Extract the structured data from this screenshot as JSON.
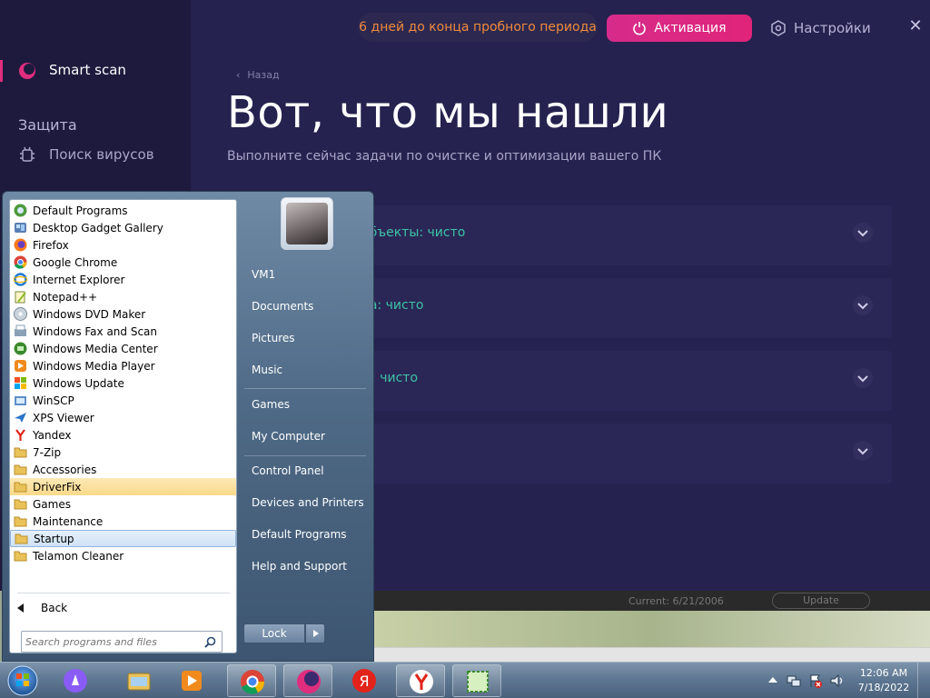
{
  "app": {
    "trial_text": "6 дней до конца пробного периода",
    "activate_label": "Активация",
    "settings_label": "Настройки",
    "close_glyph": "✕",
    "accent_color": "#e0247a",
    "sidebar": {
      "active_item": "Smart scan",
      "section_title": "Защита",
      "sub_item": "Поиск вирусов"
    },
    "back_label": "Назад",
    "title": "Вот, что мы нашли",
    "subtitle": "Выполните сейчас задачи по очистке и оптимизации вашего ПК",
    "results": [
      {
        "text": "объекты: чисто",
        "status_color": "#3fc3a6"
      },
      {
        "text": "ра: чисто",
        "status_color": "#3fc3a6"
      },
      {
        "text": "ы: чисто",
        "status_color": "#3fc3a6"
      },
      {
        "text": ""
      }
    ],
    "status_strip": {
      "current": "Current: 6/21/2006",
      "update": "Update"
    }
  },
  "start_menu": {
    "programs": [
      {
        "label": "Default Programs",
        "icon": "default-programs-icon"
      },
      {
        "label": "Desktop Gadget Gallery",
        "icon": "gadget-icon"
      },
      {
        "label": "Firefox",
        "icon": "firefox-icon"
      },
      {
        "label": "Google Chrome",
        "icon": "chrome-icon"
      },
      {
        "label": "Internet Explorer",
        "icon": "ie-icon"
      },
      {
        "label": "Notepad++",
        "icon": "notepadpp-icon"
      },
      {
        "label": "Windows DVD Maker",
        "icon": "dvd-icon"
      },
      {
        "label": "Windows Fax and Scan",
        "icon": "fax-icon"
      },
      {
        "label": "Windows Media Center",
        "icon": "media-center-icon"
      },
      {
        "label": "Windows Media Player",
        "icon": "media-player-icon"
      },
      {
        "label": "Windows Update",
        "icon": "update-icon"
      },
      {
        "label": "WinSCP",
        "icon": "winscp-icon"
      },
      {
        "label": "XPS Viewer",
        "icon": "xps-icon"
      },
      {
        "label": "Yandex",
        "icon": "yandex-icon"
      },
      {
        "label": "7-Zip",
        "icon": "folder-icon"
      },
      {
        "label": "Accessories",
        "icon": "folder-icon"
      },
      {
        "label": "DriverFix",
        "icon": "folder-icon",
        "highlight": "new"
      },
      {
        "label": "Games",
        "icon": "folder-icon"
      },
      {
        "label": "Maintenance",
        "icon": "folder-icon"
      },
      {
        "label": "Startup",
        "icon": "folder-icon",
        "highlight": "hover"
      },
      {
        "label": "Telamon Cleaner",
        "icon": "folder-icon"
      }
    ],
    "back_label": "Back",
    "search_placeholder": "Search programs and files",
    "right_items": [
      {
        "label": "VM1"
      },
      {
        "label": "Documents"
      },
      {
        "label": "Pictures"
      },
      {
        "label": "Music"
      },
      {
        "label": "Games"
      },
      {
        "label": "My Computer"
      },
      {
        "label": "Control Panel"
      },
      {
        "label": "Devices and Printers"
      },
      {
        "label": "Default Programs"
      },
      {
        "label": "Help and Support"
      }
    ],
    "lock_label": "Lock"
  },
  "taskbar": {
    "apps": [
      {
        "name": "alice",
        "icon": "alice-icon"
      },
      {
        "name": "explorer",
        "icon": "explorer-icon"
      },
      {
        "name": "media-player",
        "icon": "media-player-icon"
      },
      {
        "name": "chrome",
        "icon": "chrome-icon"
      },
      {
        "name": "cleaner",
        "icon": "cleaner-icon"
      },
      {
        "name": "yandex",
        "icon": "yandex-browser-icon"
      },
      {
        "name": "yandex-alt",
        "icon": "yandex-icon"
      },
      {
        "name": "snip",
        "icon": "snip-icon"
      }
    ],
    "time": "12:06 AM",
    "date": "7/18/2022"
  }
}
